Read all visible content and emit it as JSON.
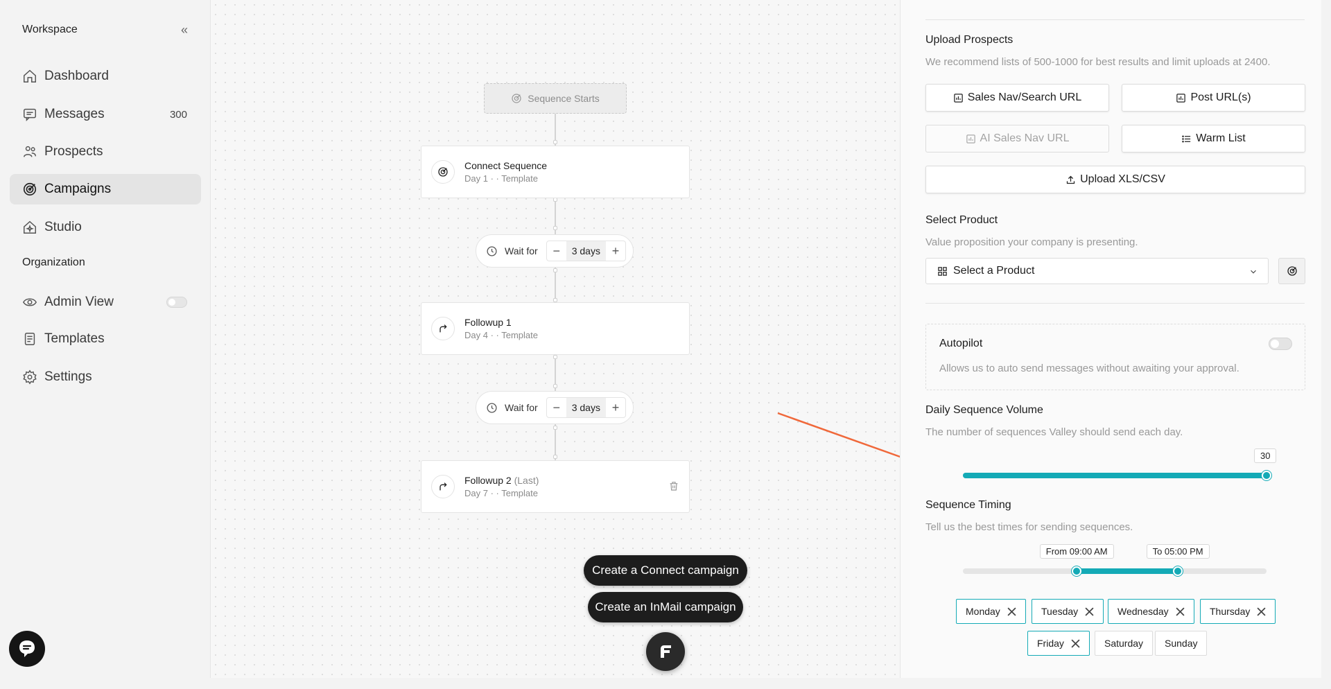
{
  "sidebar": {
    "workspace_title": "Workspace",
    "collapse_glyph": "«",
    "items": [
      {
        "label": "Dashboard",
        "icon": "home-icon"
      },
      {
        "label": "Messages",
        "icon": "message-icon",
        "count": "300"
      },
      {
        "label": "Prospects",
        "icon": "users-icon"
      },
      {
        "label": "Campaigns",
        "icon": "target-icon",
        "active": true
      },
      {
        "label": "Studio",
        "icon": "studio-icon"
      }
    ],
    "org_title": "Organization",
    "org_items": [
      {
        "label": "Admin View",
        "icon": "eye-icon",
        "toggle": false
      },
      {
        "label": "Templates",
        "icon": "document-icon"
      },
      {
        "label": "Settings",
        "icon": "gear-icon"
      }
    ]
  },
  "canvas": {
    "start_label": "Sequence Starts",
    "steps": [
      {
        "title": "Connect Sequence",
        "title_suffix": "",
        "sub": "Day 1 · · Template"
      },
      {
        "title": "Followup 1",
        "title_suffix": "",
        "sub": "Day 4 · · Template"
      },
      {
        "title": "Followup 2",
        "title_suffix": "(Last)",
        "sub": "Day 7 · · Template"
      }
    ],
    "waits": [
      {
        "label": "Wait for",
        "value": "3 days",
        "minus": "−",
        "plus": "+"
      },
      {
        "label": "Wait for",
        "value": "3 days",
        "minus": "−",
        "plus": "+"
      }
    ],
    "create_connect": "Create a Connect campaign",
    "create_inmail": "Create an InMail campaign"
  },
  "panel": {
    "upload": {
      "title": "Upload Prospects",
      "desc": "We recommend lists of 500-1000 for best results and limit uploads at 2400.",
      "btn_sales_nav": "Sales Nav/Search URL",
      "btn_post": "Post URL(s)",
      "btn_ai": "AI Sales Nav URL",
      "btn_warm": "Warm List",
      "btn_upload": "Upload XLS/CSV"
    },
    "product": {
      "title": "Select Product",
      "desc": "Value proposition your company is presenting.",
      "select_value": "Select a Product"
    },
    "autopilot": {
      "title": "Autopilot",
      "desc": "Allows us to auto send messages without awaiting your approval.",
      "enabled": false
    },
    "volume": {
      "title": "Daily Sequence Volume",
      "desc": "The number of sequences Valley should send each day.",
      "value": "30",
      "fraction": 1.0
    },
    "timing": {
      "title": "Sequence Timing",
      "desc": "Tell us the best times for sending sequences.",
      "from_label": "From 09:00 AM",
      "to_label": "To 05:00 PM",
      "from_fraction": 0.375,
      "to_fraction": 0.708
    },
    "days": [
      {
        "label": "Monday",
        "selected": true
      },
      {
        "label": "Tuesday",
        "selected": true
      },
      {
        "label": "Wednesday",
        "selected": true
      },
      {
        "label": "Thursday",
        "selected": true
      },
      {
        "label": "Friday",
        "selected": true
      },
      {
        "label": "Saturday",
        "selected": false
      },
      {
        "label": "Sunday",
        "selected": false
      }
    ]
  },
  "colors": {
    "accent": "#14aab6",
    "arrow": "#f0683a",
    "dark_button": "#1d1d1d"
  }
}
